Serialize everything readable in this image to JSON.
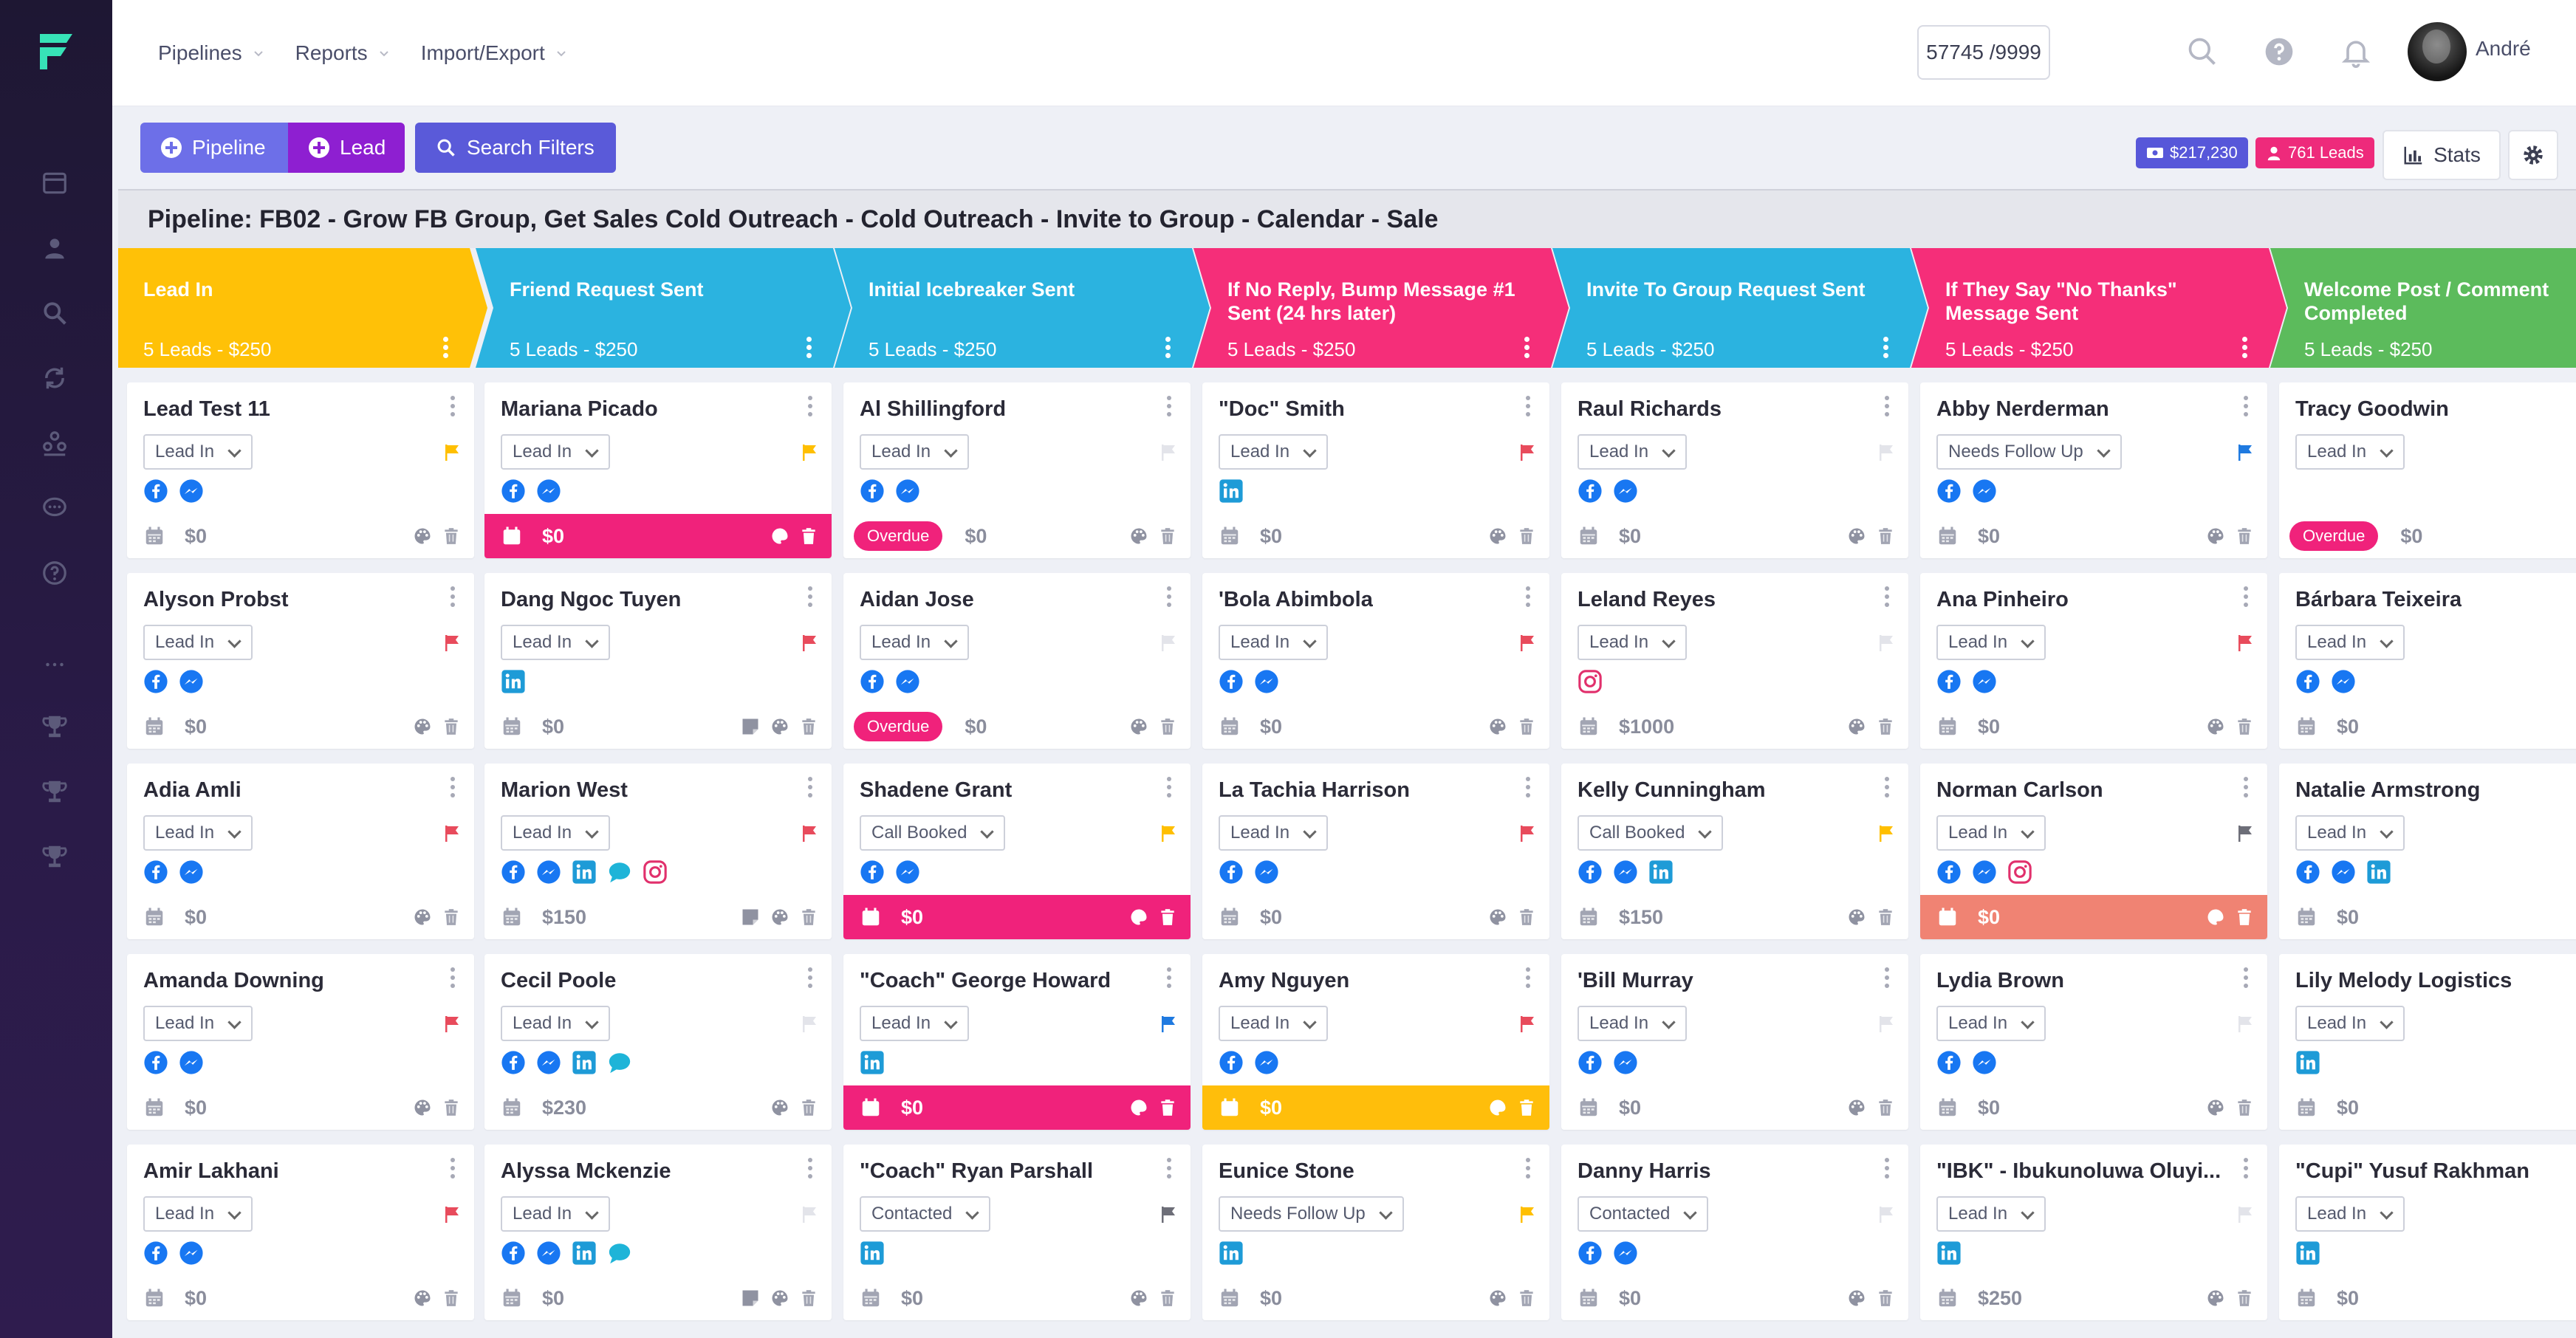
{
  "header": {
    "nav": [
      {
        "label": "Pipelines"
      },
      {
        "label": "Reports"
      },
      {
        "label": "Import/Export"
      }
    ],
    "credits": "57745 /9999",
    "username": "André"
  },
  "toolbar": {
    "pipeline_label": "Pipeline",
    "lead_label": "Lead",
    "filters_label": "Search Filters",
    "money_badge": "$217,230",
    "leads_badge": "761 Leads",
    "stats_label": "Stats"
  },
  "pipeline_title": "Pipeline: FB02 - Grow FB Group, Get Sales Cold Outreach - Cold Outreach - Invite to Group - Calendar - Sale",
  "stages": [
    {
      "name": "Lead In",
      "meta": "5 Leads - $250",
      "color": "#ffc107"
    },
    {
      "name": "Friend Request Sent",
      "meta": "5 Leads - $250",
      "color": "#2bb3e0"
    },
    {
      "name": "Initial Icebreaker Sent",
      "meta": "5 Leads - $250",
      "color": "#2bb3e0"
    },
    {
      "name": "If No Reply, Bump Message #1 Sent (24 hrs later)",
      "meta": "5 Leads - $250",
      "color": "#f52e79"
    },
    {
      "name": "Invite To Group Request Sent",
      "meta": "5 Leads - $250",
      "color": "#2bb3e0"
    },
    {
      "name": "If They Say \"No Thanks\" Message Sent",
      "meta": "5 Leads - $250",
      "color": "#f52e79"
    },
    {
      "name": "Welcome Post / Comment Completed",
      "meta": "5 Leads - $250",
      "color": "#5cbb5c"
    }
  ],
  "cards": [
    [
      {
        "name": "Lead Test 11",
        "status": "Lead In",
        "flag": "#ffbf00",
        "socials": [
          "fb",
          "ms"
        ],
        "amount": "$0",
        "footer": "",
        "overdue": false,
        "note": false
      },
      {
        "name": "Alyson Probst",
        "status": "Lead In",
        "flag": "#e84b5c",
        "socials": [
          "fb",
          "ms"
        ],
        "amount": "$0",
        "footer": "",
        "overdue": false,
        "note": false
      },
      {
        "name": "Adia Amli",
        "status": "Lead In",
        "flag": "#e84b5c",
        "socials": [
          "fb",
          "ms"
        ],
        "amount": "$0",
        "footer": "",
        "overdue": false,
        "note": false
      },
      {
        "name": "Amanda Downing",
        "status": "Lead In",
        "flag": "#e84b5c",
        "socials": [
          "fb",
          "ms"
        ],
        "amount": "$0",
        "footer": "",
        "overdue": false,
        "note": false
      },
      {
        "name": "Amir Lakhani",
        "status": "Lead In",
        "flag": "#e84b5c",
        "socials": [
          "fb",
          "ms"
        ],
        "amount": "$0",
        "footer": "",
        "overdue": false,
        "note": false
      }
    ],
    [
      {
        "name": "Mariana Picado",
        "status": "Lead In",
        "flag": "#ffbf00",
        "socials": [
          "fb",
          "ms"
        ],
        "amount": "$0",
        "footer": "pink",
        "overdue": false,
        "note": false
      },
      {
        "name": "Dang Ngoc Tuyen",
        "status": "Lead In",
        "flag": "#e84b5c",
        "socials": [
          "li"
        ],
        "amount": "$0",
        "footer": "",
        "overdue": false,
        "note": true
      },
      {
        "name": "Marion West",
        "status": "Lead In",
        "flag": "#e84b5c",
        "socials": [
          "fb",
          "ms",
          "li",
          "ch",
          "ig"
        ],
        "amount": "$150",
        "footer": "",
        "overdue": false,
        "note": true
      },
      {
        "name": "Cecil Poole",
        "status": "Lead In",
        "flag": "#e3e4ea",
        "socials": [
          "fb",
          "ms",
          "li",
          "ch"
        ],
        "amount": "$230",
        "footer": "",
        "overdue": false,
        "note": false
      },
      {
        "name": "Alyssa Mckenzie",
        "status": "Lead In",
        "flag": "#e3e4ea",
        "socials": [
          "fb",
          "ms",
          "li",
          "ch"
        ],
        "amount": "$0",
        "footer": "",
        "overdue": false,
        "note": true
      }
    ],
    [
      {
        "name": "Al Shillingford",
        "status": "Lead In",
        "flag": "#e3e4ea",
        "socials": [
          "fb",
          "ms"
        ],
        "amount": "$0",
        "footer": "",
        "overdue": true,
        "note": false
      },
      {
        "name": "Aidan Jose",
        "status": "Lead In",
        "flag": "#e3e4ea",
        "socials": [
          "fb",
          "ms"
        ],
        "amount": "$0",
        "footer": "",
        "overdue": true,
        "note": false
      },
      {
        "name": "Shadene Grant",
        "status": "Call Booked",
        "flag": "#ffbf00",
        "socials": [
          "fb",
          "ms"
        ],
        "amount": "$0",
        "footer": "pink",
        "overdue": false,
        "note": false
      },
      {
        "name": "\"Coach\" George Howard",
        "status": "Lead In",
        "flag": "#1f7ae0",
        "socials": [
          "li"
        ],
        "amount": "$0",
        "footer": "pink",
        "overdue": false,
        "note": false
      },
      {
        "name": "\"Coach\" Ryan Parshall",
        "status": "Contacted",
        "flag": "#6d6e78",
        "socials": [
          "li"
        ],
        "amount": "$0",
        "footer": "",
        "overdue": false,
        "note": false
      }
    ],
    [
      {
        "name": "\"Doc\" Smith",
        "status": "Lead In",
        "flag": "#e84b5c",
        "socials": [
          "li"
        ],
        "amount": "$0",
        "footer": "",
        "overdue": false,
        "note": false
      },
      {
        "name": "'Bola Abimbola",
        "status": "Lead In",
        "flag": "#e84b5c",
        "socials": [
          "fb",
          "ms"
        ],
        "amount": "$0",
        "footer": "",
        "overdue": false,
        "note": false
      },
      {
        "name": "La Tachia Harrison",
        "status": "Lead In",
        "flag": "#e84b5c",
        "socials": [
          "fb",
          "ms"
        ],
        "amount": "$0",
        "footer": "",
        "overdue": false,
        "note": false
      },
      {
        "name": "Amy Nguyen",
        "status": "Lead In",
        "flag": "#e84b5c",
        "socials": [
          "fb",
          "ms"
        ],
        "amount": "$0",
        "footer": "yellow",
        "overdue": false,
        "note": false
      },
      {
        "name": "Eunice Stone",
        "status": "Needs Follow Up",
        "flag": "#ffbf00",
        "socials": [
          "li"
        ],
        "amount": "$0",
        "footer": "",
        "overdue": false,
        "note": false
      }
    ],
    [
      {
        "name": "Raul Richards",
        "status": "Lead In",
        "flag": "#e3e4ea",
        "socials": [
          "fb",
          "ms"
        ],
        "amount": "$0",
        "footer": "",
        "overdue": false,
        "note": false
      },
      {
        "name": "Leland Reyes",
        "status": "Lead In",
        "flag": "#e3e4ea",
        "socials": [
          "ig"
        ],
        "amount": "$1000",
        "footer": "",
        "overdue": false,
        "note": false
      },
      {
        "name": "Kelly Cunningham",
        "status": "Call Booked",
        "flag": "#ffbf00",
        "socials": [
          "fb",
          "ms",
          "li"
        ],
        "amount": "$150",
        "footer": "",
        "overdue": false,
        "note": false
      },
      {
        "name": "'Bill Murray",
        "status": "Lead In",
        "flag": "#e3e4ea",
        "socials": [
          "fb",
          "ms"
        ],
        "amount": "$0",
        "footer": "",
        "overdue": false,
        "note": false
      },
      {
        "name": "Danny Harris",
        "status": "Contacted",
        "flag": "#e3e4ea",
        "socials": [
          "fb",
          "ms"
        ],
        "amount": "$0",
        "footer": "",
        "overdue": false,
        "note": false
      }
    ],
    [
      {
        "name": "Abby Nerderman",
        "status": "Needs Follow Up",
        "flag": "#1f7ae0",
        "socials": [
          "fb",
          "ms"
        ],
        "amount": "$0",
        "footer": "",
        "overdue": false,
        "note": false
      },
      {
        "name": "Ana Pinheiro",
        "status": "Lead In",
        "flag": "#e84b5c",
        "socials": [
          "fb",
          "ms"
        ],
        "amount": "$0",
        "footer": "",
        "overdue": false,
        "note": false
      },
      {
        "name": "Norman Carlson",
        "status": "Lead In",
        "flag": "#6d6e78",
        "socials": [
          "fb",
          "ms",
          "ig"
        ],
        "amount": "$0",
        "footer": "salmon",
        "overdue": false,
        "note": false
      },
      {
        "name": "Lydia Brown",
        "status": "Lead In",
        "flag": "#e3e4ea",
        "socials": [
          "fb",
          "ms"
        ],
        "amount": "$0",
        "footer": "",
        "overdue": false,
        "note": false
      },
      {
        "name": "\"IBK\" - Ibukunoluwa Oluyi...",
        "status": "Lead In",
        "flag": "#e3e4ea",
        "socials": [
          "li"
        ],
        "amount": "$250",
        "footer": "",
        "overdue": false,
        "note": false
      }
    ],
    [
      {
        "name": "Tracy Goodwin",
        "status": "Lead In",
        "flag": "",
        "socials": [],
        "amount": "$0",
        "footer": "",
        "overdue": true,
        "note": true
      },
      {
        "name": "Bárbara Teixeira",
        "status": "Lead In",
        "flag": "",
        "socials": [
          "fb",
          "ms"
        ],
        "amount": "$0",
        "footer": "",
        "overdue": false,
        "note": false
      },
      {
        "name": "Natalie Armstrong",
        "status": "Lead In",
        "flag": "",
        "socials": [
          "fb",
          "ms",
          "li"
        ],
        "amount": "$0",
        "footer": "",
        "overdue": false,
        "note": false
      },
      {
        "name": "Lily Melody Logistics",
        "status": "Lead In",
        "flag": "",
        "socials": [
          "li"
        ],
        "amount": "$0",
        "footer": "",
        "overdue": false,
        "note": false
      },
      {
        "name": "\"Cupi\" Yusuf Rakhman",
        "status": "Lead In",
        "flag": "",
        "socials": [
          "li"
        ],
        "amount": "$0",
        "footer": "",
        "overdue": false,
        "note": false
      }
    ]
  ]
}
